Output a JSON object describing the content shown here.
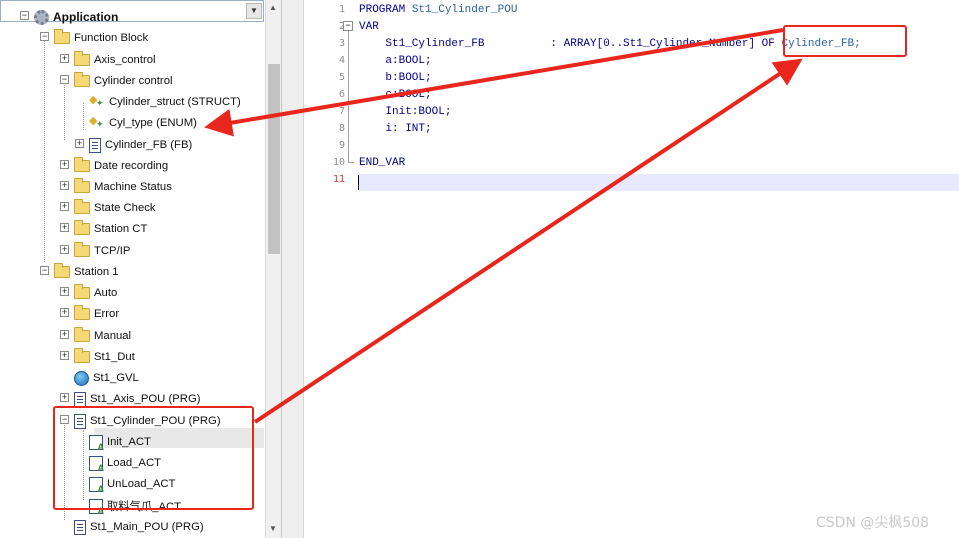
{
  "tree": {
    "items": [
      {
        "label": "Application",
        "icon": "gear-icon",
        "exp": "−"
      },
      {
        "label": "Function Block",
        "icon": "folder-open-icon",
        "exp": "−"
      },
      {
        "label": "Axis_control",
        "icon": "folder-icon",
        "exp": "+"
      },
      {
        "label": "Cylinder control",
        "icon": "folder-open-icon",
        "exp": "−"
      },
      {
        "label": "Cylinder_struct (STRUCT)",
        "icon": "struct-icon",
        "exp": ""
      },
      {
        "label": "Cyl_type (ENUM)",
        "icon": "enum-icon",
        "exp": ""
      },
      {
        "label": "Cylinder_FB (FB)",
        "icon": "function-block-icon",
        "exp": "+"
      },
      {
        "label": "Date recording",
        "icon": "folder-icon",
        "exp": "+"
      },
      {
        "label": "Machine Status",
        "icon": "folder-icon",
        "exp": "+"
      },
      {
        "label": "State Check",
        "icon": "folder-icon",
        "exp": "+"
      },
      {
        "label": "Station CT",
        "icon": "folder-icon",
        "exp": "+"
      },
      {
        "label": "TCP/IP",
        "icon": "folder-icon",
        "exp": "+"
      },
      {
        "label": "Station 1",
        "icon": "folder-open-icon",
        "exp": "−"
      },
      {
        "label": "Auto",
        "icon": "folder-icon",
        "exp": "+"
      },
      {
        "label": "Error",
        "icon": "folder-icon",
        "exp": "+"
      },
      {
        "label": "Manual",
        "icon": "folder-icon",
        "exp": "+"
      },
      {
        "label": "St1_Dut",
        "icon": "folder-icon",
        "exp": "+"
      },
      {
        "label": "St1_GVL",
        "icon": "globe-icon",
        "exp": ""
      },
      {
        "label": "St1_Axis_POU (PRG)",
        "icon": "program-icon",
        "exp": "+"
      },
      {
        "label": "St1_Cylinder_POU (PRG)",
        "icon": "program-icon",
        "exp": "−"
      },
      {
        "label": "Init_ACT",
        "icon": "action-icon",
        "exp": ""
      },
      {
        "label": "Load_ACT",
        "icon": "action-icon",
        "exp": ""
      },
      {
        "label": "UnLoad_ACT",
        "icon": "action-icon",
        "exp": ""
      },
      {
        "label": "取料气爪_ACT",
        "icon": "action-icon",
        "exp": ""
      },
      {
        "label": "St1_Main_POU (PRG)",
        "icon": "program-icon",
        "exp": ""
      }
    ],
    "selected_item": "Init_ACT"
  },
  "editor": {
    "current_line": 11,
    "lines": [
      {
        "num": "1",
        "parts": [
          {
            "t": "PROGRAM ",
            "c": "kw"
          },
          {
            "t": "St1_Cylinder_POU",
            "c": "id"
          }
        ]
      },
      {
        "num": "2",
        "parts": [
          {
            "t": "VAR",
            "c": "kw"
          }
        ]
      },
      {
        "num": "3",
        "parts": [
          {
            "t": "    St1_Cylinder_FB          : ARRAY[0..St1_Cylinder_Number] ",
            "c": "kw"
          },
          {
            "t": "OF ",
            "c": "kw"
          },
          {
            "t": "Cylinder_FB;",
            "c": "id"
          }
        ]
      },
      {
        "num": "4",
        "parts": [
          {
            "t": "    a:BOOL;",
            "c": "kw"
          }
        ]
      },
      {
        "num": "5",
        "parts": [
          {
            "t": "    b:BOOL;",
            "c": "kw"
          }
        ]
      },
      {
        "num": "6",
        "parts": [
          {
            "t": "    c:BOOL;",
            "c": "kw"
          }
        ]
      },
      {
        "num": "7",
        "parts": [
          {
            "t": "    Init:BOOL;",
            "c": "kw"
          }
        ]
      },
      {
        "num": "8",
        "parts": [
          {
            "t": "    i: INT;",
            "c": "kw"
          }
        ]
      },
      {
        "num": "9",
        "parts": []
      },
      {
        "num": "10",
        "parts": [
          {
            "t": "END_VAR",
            "c": "kw"
          }
        ]
      },
      {
        "num": "11",
        "parts": []
      }
    ]
  },
  "watermark": "CSDN @尖枫508",
  "colors": {
    "annotation": "#e8261c",
    "current_line": "#e8e8ff",
    "keyword": "#00008b"
  }
}
